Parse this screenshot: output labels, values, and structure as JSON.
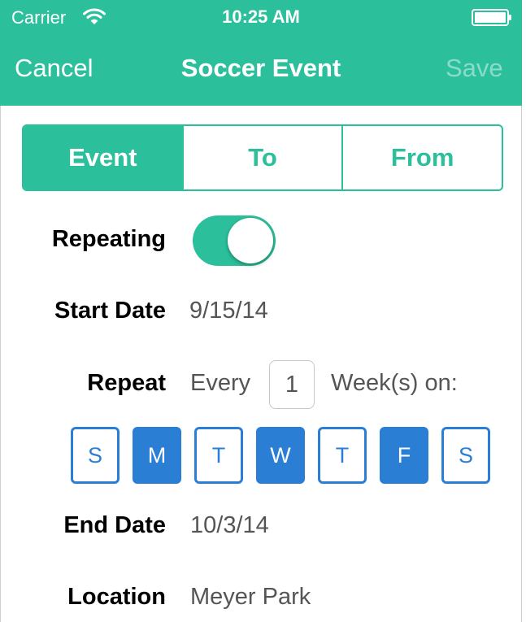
{
  "status_bar": {
    "carrier": "Carrier",
    "time": "10:25 AM",
    "wifi_icon": "wifi-icon",
    "battery_icon": "battery-icon"
  },
  "nav": {
    "cancel": "Cancel",
    "title": "Soccer Event",
    "save": "Save",
    "save_enabled": false
  },
  "tabs": [
    {
      "label": "Event",
      "active": true
    },
    {
      "label": "To",
      "active": false
    },
    {
      "label": "From",
      "active": false
    }
  ],
  "form": {
    "repeating": {
      "label": "Repeating",
      "on": true
    },
    "start_date": {
      "label": "Start Date",
      "value": "9/15/14"
    },
    "repeat": {
      "label": "Repeat",
      "prefix": "Every",
      "interval": "1",
      "suffix": "Week(s) on:"
    },
    "days": [
      {
        "label": "S",
        "selected": false
      },
      {
        "label": "M",
        "selected": true
      },
      {
        "label": "T",
        "selected": false
      },
      {
        "label": "W",
        "selected": true
      },
      {
        "label": "T",
        "selected": false
      },
      {
        "label": "F",
        "selected": true
      },
      {
        "label": "S",
        "selected": false
      }
    ],
    "end_date": {
      "label": "End Date",
      "value": "10/3/14"
    },
    "location": {
      "label": "Location",
      "value": "Meyer Park"
    }
  },
  "colors": {
    "accent": "#2bbf9b",
    "day_blue": "#2a7fd4",
    "value_gray": "#555555"
  }
}
